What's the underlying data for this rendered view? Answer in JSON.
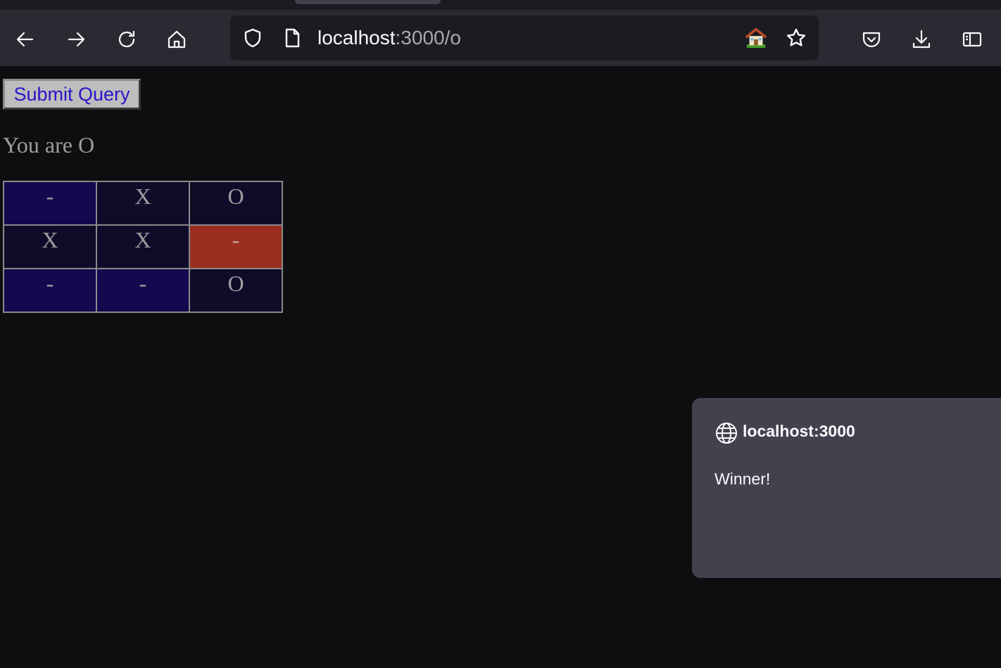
{
  "browser": {
    "url_host": "localhost",
    "url_path": ":3000/o",
    "icons": {
      "back": "arrow-left-icon",
      "forward": "arrow-right-icon",
      "reload": "reload-icon",
      "home": "home-icon",
      "tracking_protection": "shield-icon",
      "page_info": "page-icon",
      "bookmark": "star-icon",
      "pocket": "pocket-icon",
      "downloads": "download-icon",
      "sidebar": "sidebar-icon"
    }
  },
  "page": {
    "submit_label": "Submit Query",
    "player_text": "You are O",
    "board": [
      [
        "-",
        "X",
        "O"
      ],
      [
        "X",
        "X",
        "-"
      ],
      [
        "-",
        "-",
        "O"
      ]
    ],
    "colors": {
      "empty_cell": "#13094e",
      "filled_cell": "#0f0c2a",
      "highlight_cell": "#9b2e20"
    }
  },
  "dialog": {
    "origin": "localhost:3000",
    "message": "Winner!",
    "icon": "globe-icon"
  }
}
